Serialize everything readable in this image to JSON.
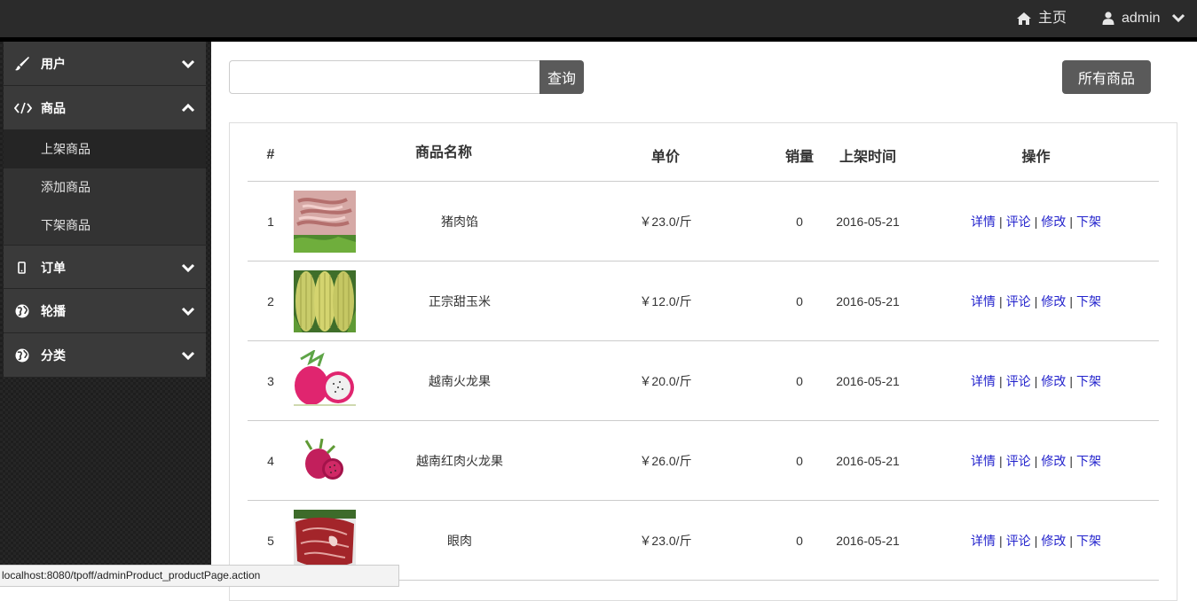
{
  "topbar": {
    "home_label": "主页",
    "user_label": "admin"
  },
  "sidebar": {
    "menus": [
      {
        "label": "用户",
        "icon": "brush-icon",
        "expanded": false
      },
      {
        "label": "商品",
        "icon": "code-icon",
        "expanded": true,
        "items": [
          {
            "label": "上架商品",
            "active": true
          },
          {
            "label": "添加商品",
            "active": false
          },
          {
            "label": "下架商品",
            "active": false
          }
        ]
      },
      {
        "label": "订单",
        "icon": "mobile-icon",
        "expanded": false
      },
      {
        "label": "轮播",
        "icon": "globe-icon",
        "expanded": false
      },
      {
        "label": "分类",
        "icon": "globe-icon",
        "expanded": false
      }
    ]
  },
  "search": {
    "value": "",
    "button_label": "查询"
  },
  "all_products_label": "所有商品",
  "table": {
    "headers": [
      "#",
      "商品名称",
      "单价",
      "销量",
      "上架时间",
      "操作"
    ],
    "rows": [
      {
        "index": "1",
        "name": "猪肉馅",
        "price": "￥23.0/斤",
        "sales": "0",
        "date": "2016-05-21",
        "image": "pork-mince"
      },
      {
        "index": "2",
        "name": "正宗甜玉米",
        "price": "￥12.0/斤",
        "sales": "0",
        "date": "2016-05-21",
        "image": "corn"
      },
      {
        "index": "3",
        "name": "越南火龙果",
        "price": "￥20.0/斤",
        "sales": "0",
        "date": "2016-05-21",
        "image": "dragonfruit"
      },
      {
        "index": "4",
        "name": "越南红肉火龙果",
        "price": "￥26.0/斤",
        "sales": "0",
        "date": "2016-05-21",
        "image": "red-dragonfruit"
      },
      {
        "index": "5",
        "name": "眼肉",
        "price": "￥23.0/斤",
        "sales": "0",
        "date": "2016-05-21",
        "image": "beef-steak"
      }
    ],
    "actions": [
      "详情",
      "评论",
      "修改",
      "下架"
    ]
  },
  "status_url": "localhost:8080/tpoff/adminProduct_productPage.action",
  "colors": {
    "topbar": "#2b2b2b",
    "sidebar": "#3a3a3a",
    "button": "#5a5a5a",
    "link": "#2222cc"
  }
}
